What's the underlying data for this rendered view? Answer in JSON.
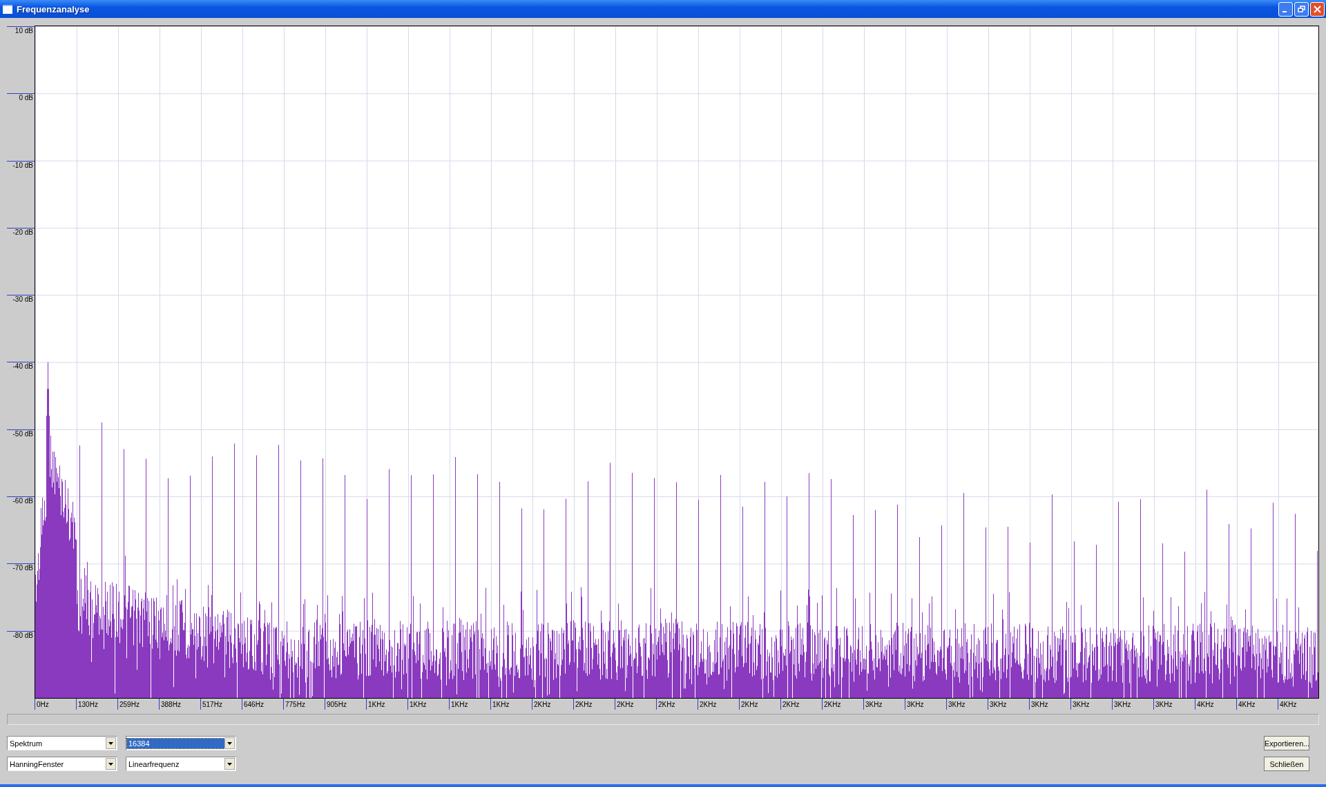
{
  "window": {
    "title": "Frequenzanalyse"
  },
  "chart": {
    "y_axis_labels": [
      "10 dB",
      "0 dB",
      "-10 dB",
      "-20 dB",
      "-30 dB",
      "-40 dB",
      "-50 dB",
      "-60 dB",
      "-70 dB",
      "-80 dB"
    ],
    "x_axis_labels": [
      "0Hz",
      "130Hz",
      "259Hz",
      "388Hz",
      "517Hz",
      "646Hz",
      "775Hz",
      "905Hz",
      "1KHz",
      "1KHz",
      "1KHz",
      "1KHz",
      "2KHz",
      "2KHz",
      "2KHz",
      "2KHz",
      "2KHz",
      "2KHz",
      "2KHz",
      "2KHz",
      "3KHz",
      "3KHz",
      "3KHz",
      "3KHz",
      "3KHz",
      "3KHz",
      "3KHz",
      "3KHz",
      "4KHz",
      "4KHz",
      "4KHz"
    ]
  },
  "dropdowns": [
    {
      "value": "Spektrum",
      "selected": false
    },
    {
      "value": "16384",
      "selected": true
    },
    {
      "value": "HanningFenster",
      "selected": false
    },
    {
      "value": "Linearfrequenz",
      "selected": false
    }
  ],
  "buttons": [
    "Exportieren...",
    "Schließen"
  ]
}
